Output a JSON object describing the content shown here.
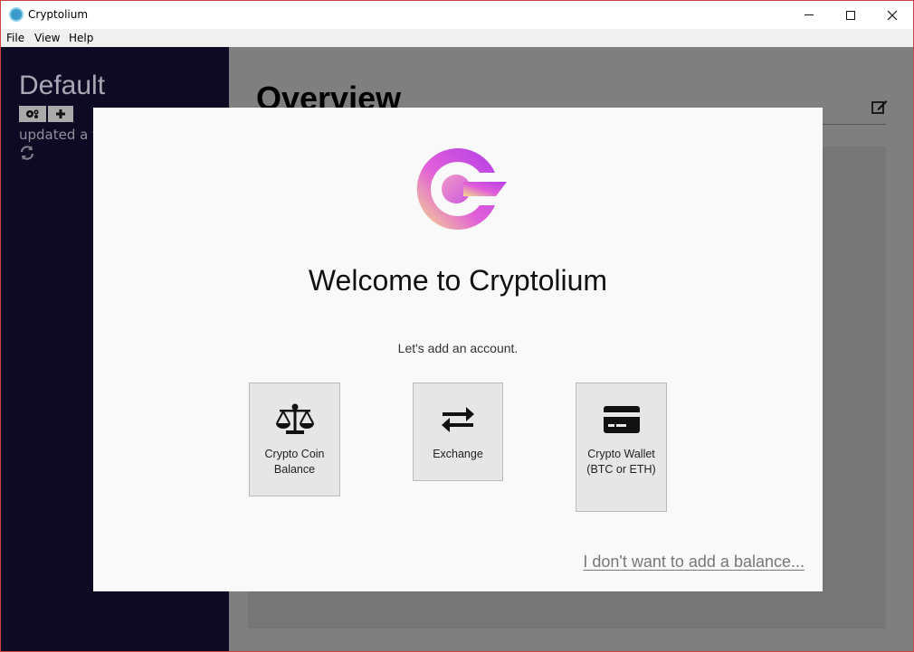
{
  "window": {
    "title": "Cryptolium",
    "icon": "cryptolium-app-icon"
  },
  "menu": {
    "file": "File",
    "view": "View",
    "help": "Help"
  },
  "sidebar": {
    "profile_name": "Default",
    "updated_text": "updated a f",
    "buttons": [
      "gears-icon",
      "plus-icon"
    ],
    "refresh_icon": "refresh-icon"
  },
  "main": {
    "title": "Overview",
    "edit_icon": "edit-icon"
  },
  "modal": {
    "welcome": "Welcome to Cryptolium",
    "subtitle": "Let's add an account.",
    "options": [
      {
        "icon": "balance-scale-icon",
        "label": "Crypto Coin Balance"
      },
      {
        "icon": "exchange-arrows-icon",
        "label": "Exchange"
      },
      {
        "icon": "credit-card-icon",
        "label": "Crypto Wallet (BTC or ETH)"
      }
    ],
    "skip_link": "I don't want to add a balance..."
  },
  "colors": {
    "sidebar_bg": "#0f0a24",
    "overlay": "#7f7f7f",
    "modal_bg": "#f9f9f9",
    "logo_gradient_start": "#f5e08a",
    "logo_gradient_end": "#b33ee8"
  }
}
